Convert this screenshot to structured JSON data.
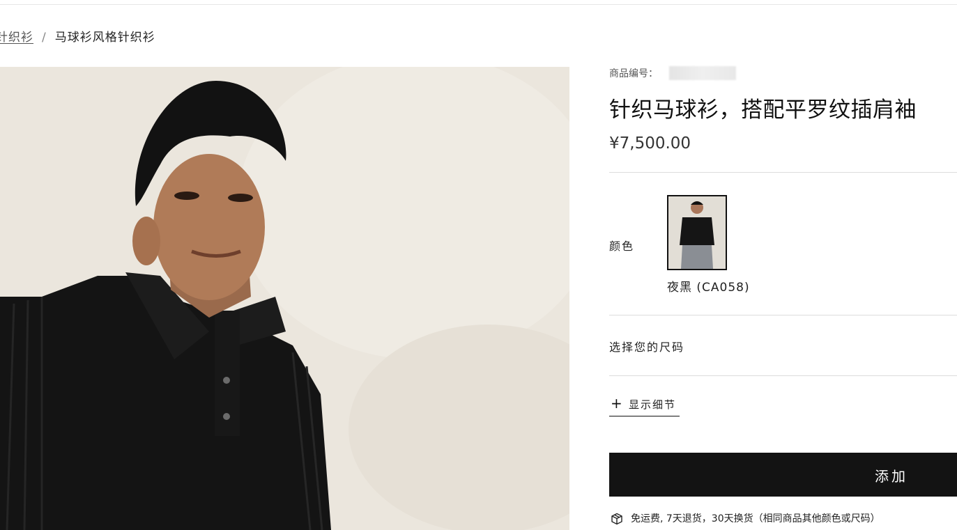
{
  "breadcrumb": {
    "parent": "针织衫",
    "separator": "/",
    "current": "马球衫风格针织衫"
  },
  "hero": {
    "alt_icon": "model-photo"
  },
  "product": {
    "sku_label": "商品编号：",
    "title": "针织马球衫，搭配平罗纹插肩袖",
    "price": "¥7,500.00"
  },
  "color": {
    "label": "颜色",
    "selected_name": "夜黑 (CA058)"
  },
  "size": {
    "label": "选择您的尺码"
  },
  "details": {
    "icon": "+",
    "label": "显示细节"
  },
  "cart": {
    "add_label": "添加"
  },
  "shipping": {
    "icon": "box-icon",
    "text": "免运费, 7天退货，30天换货（相同商品其他颜色或尺码）"
  },
  "colors": {
    "button_bg": "#131313",
    "text": "#1a1a1a",
    "wall": "#ebe6dd"
  }
}
